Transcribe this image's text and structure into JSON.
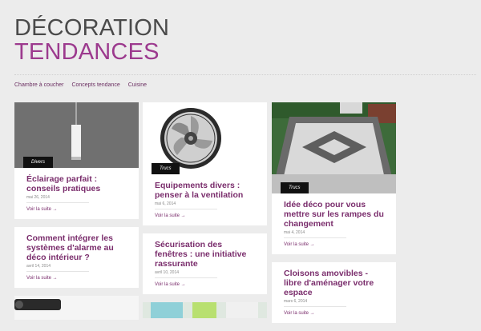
{
  "logo": {
    "line1": "DÉCORATION",
    "line2": "TENDANCES"
  },
  "nav": [
    "Chambre à coucher",
    "Concepts tendance",
    "Cuisine"
  ],
  "read_more": "Voir la suite →",
  "columns": [
    [
      {
        "tag": "Divers",
        "title": "Éclairage parfait : conseils pratiques",
        "date": "mai 26, 2014"
      },
      {
        "tag": "",
        "title": "Comment intégrer les systèmes d'alarme au déco intérieur ?",
        "date": "avril 14, 2014"
      }
    ],
    [
      {
        "tag": "Trucs",
        "title": "Equipements divers : penser à la ventilation",
        "date": "mai 6, 2014"
      },
      {
        "tag": "",
        "title": "Sécurisation des fenêtres : une initiative rassurante",
        "date": "avril 10, 2014"
      }
    ],
    [
      {
        "tag": "Trucs",
        "title": "Idée déco pour vous mettre sur les rampes du changement",
        "date": "mai 4, 2014"
      },
      {
        "tag": "",
        "title": "Cloisons amovibles - libre d'aménager votre espace",
        "date": "mars 6, 2014"
      }
    ]
  ]
}
